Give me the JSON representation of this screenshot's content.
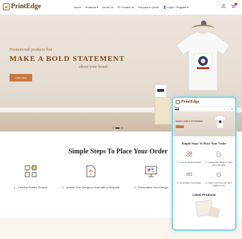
{
  "header": {
    "logo_text": "PrintEdge",
    "logo_tag": "",
    "nav": [
      "Home",
      "Products ▾",
      "About Us",
      "✉ Contact Us",
      "Request a Quote",
      "👤 Login / Register ▾"
    ],
    "icons": [
      "user-icon",
      "cart-icon"
    ],
    "cart_count": ""
  },
  "hero": {
    "line1": "Promotional products that",
    "line2": "MAKE A BOLD STATEMENT",
    "line3": "about your brand.",
    "button": "Order Now"
  },
  "steps": {
    "title": "Simple Steps To Place Your Order",
    "items": [
      {
        "label": "1 - Find the Perfect Product",
        "icon": "product-grid-icon"
      },
      {
        "label": "2 - Upload Your Design or Start with a Template",
        "icon": "upload-document-icon"
      },
      {
        "label": "3 - Personalize Your Design",
        "icon": "paint-palette-icon"
      }
    ]
  },
  "mobile": {
    "logo_text": "PrintEdge",
    "steps_title": "Simple Steps To Place Your Order",
    "items": [
      "1 - Find the Perfect Product",
      "2 - Upload Your Design or Start with a Template",
      "3 - Personalize Your Design",
      "4 - Place Your Order and Get It Ready for You"
    ],
    "latest_title": "Latest Products"
  },
  "colors": {
    "accent": "#c7763f",
    "brand": "#5a3e22",
    "mobile_frame": "#7fd6e8"
  }
}
